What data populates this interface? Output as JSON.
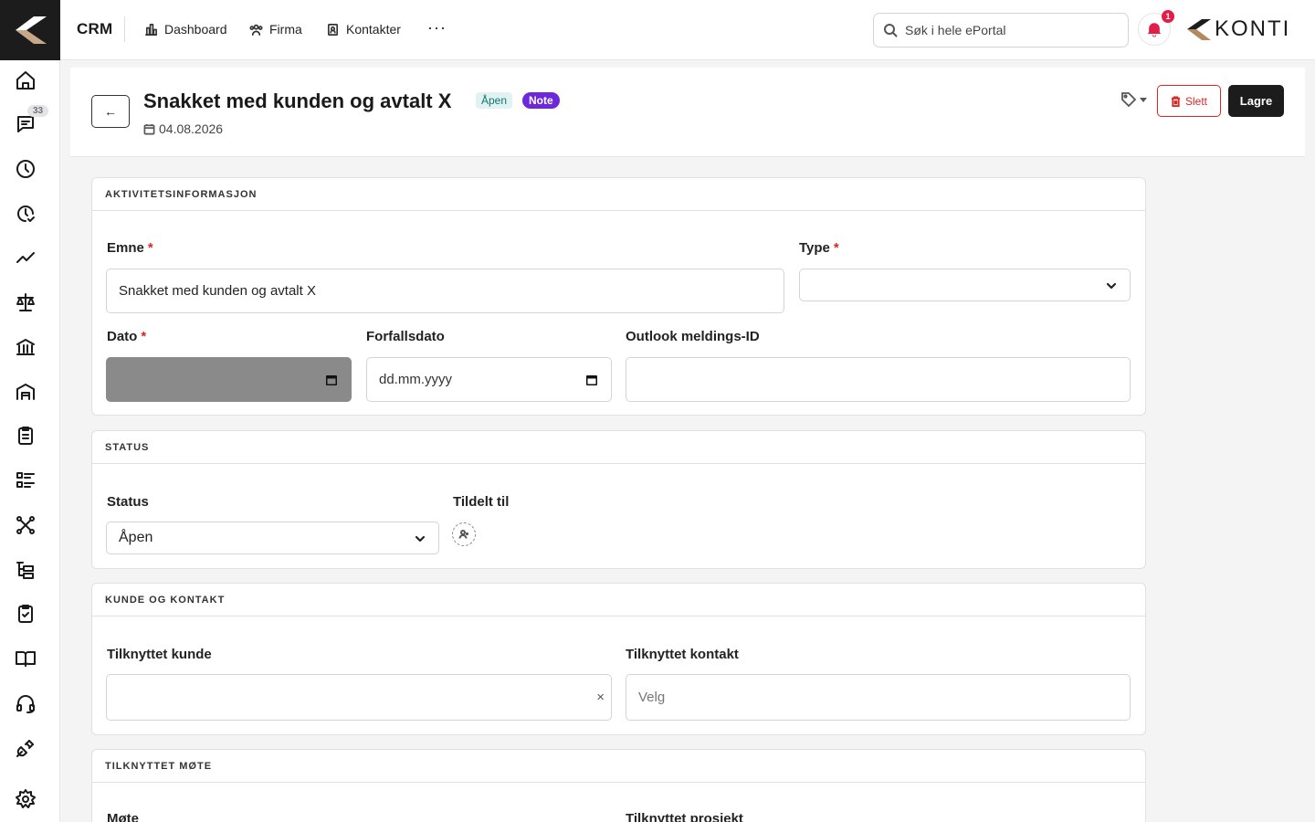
{
  "app": {
    "brand": "CRM",
    "logo_text": "KONTI"
  },
  "sidebar": {
    "messages_badge": "33",
    "icons": [
      "home-icon",
      "messages-icon",
      "clock-icon",
      "clock-check-icon",
      "trend-icon",
      "scale-icon",
      "bank-icon",
      "warehouse-icon",
      "clipboard-list-icon",
      "list-icon",
      "network-icon",
      "tree-icon",
      "clipboard-check-icon",
      "book-icon",
      "headset-icon",
      "plug-icon",
      "settings-icon"
    ]
  },
  "nav": {
    "dashboard": "Dashboard",
    "firma": "Firma",
    "kontakter": "Kontakter",
    "more": "···"
  },
  "search": {
    "placeholder": "Søk i hele ePortal"
  },
  "notifications": {
    "count": "1"
  },
  "header": {
    "back": "←",
    "title": "Snakket med kunden og avtalt X",
    "status_badge": "Åpen",
    "type_badge": "Note",
    "date": "04.08.2026",
    "delete_label": "Slett",
    "save_label": "Lagre"
  },
  "sections": {
    "activity": {
      "heading": "AKTIVITETSINFORMASJON",
      "emne_label": "Emne",
      "emne_value": "Snakket med kunden og avtalt X",
      "type_label": "Type",
      "type_value": "",
      "dato_label": "Dato",
      "dato_value": "",
      "forfallsdato_label": "Forfallsdato",
      "forfallsdato_placeholder": "dd.mm.yyyy",
      "outlook_label": "Outlook meldings-ID",
      "outlook_value": ""
    },
    "status": {
      "heading": "STATUS",
      "status_label": "Status",
      "status_value": "Åpen",
      "assigned_label": "Tildelt til"
    },
    "customer": {
      "heading": "KUNDE OG KONTAKT",
      "customer_label": "Tilknyttet kunde",
      "customer_value": "",
      "contact_label": "Tilknyttet kontakt",
      "contact_placeholder": "Velg"
    },
    "meeting": {
      "heading": "TILKNYTTET MØTE",
      "meeting_label": "Møte",
      "project_label": "Tilknyttet prosjekt"
    }
  },
  "colors": {
    "accent_dark": "#1c1c1c",
    "danger": "#dc2626",
    "note_badge": "#6d28d9",
    "open_badge_text": "#0f766e",
    "disabled_field": "#8a8a8a"
  }
}
